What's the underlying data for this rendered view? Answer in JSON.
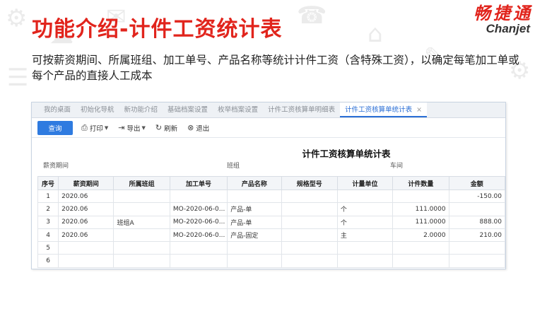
{
  "slide": {
    "title": "功能介绍-计件工资统计表",
    "logo_cn": "畅捷通",
    "logo_en": "Chanjet",
    "description": "可按薪资期间、所属班组、加工单号、产品名称等统计计件工资（含特殊工资），以确定每笔加工单或每个产品的直接人工成本"
  },
  "tabs": [
    {
      "label": "我的桌面"
    },
    {
      "label": "初始化导航"
    },
    {
      "label": "新功能介绍"
    },
    {
      "label": "基础档案设置"
    },
    {
      "label": "枚举档案设置"
    },
    {
      "label": "计件工资核算单明细表"
    },
    {
      "label": "计件工资核算单统计表",
      "active": true,
      "close": "×"
    }
  ],
  "toolbar": {
    "query": "查询",
    "print": "打印",
    "export": "导出",
    "refresh": "刷新",
    "exit": "退出"
  },
  "report": {
    "title": "计件工资核算单统计表",
    "filter_period": "薪资期间",
    "filter_group": "班组",
    "filter_workshop": "车间"
  },
  "table": {
    "headers": [
      "序号",
      "薪资期间",
      "所属班组",
      "加工单号",
      "产品名称",
      "规格型号",
      "计量单位",
      "计件数量",
      "金额"
    ],
    "rows": [
      [
        "1",
        "2020.06",
        "",
        "",
        "",
        "",
        "",
        "",
        "-150.00"
      ],
      [
        "2",
        "2020.06",
        "",
        "MO-2020-06-0...",
        "产品-单",
        "",
        "个",
        "111.0000",
        ""
      ],
      [
        "3",
        "2020.06",
        "班组A",
        "MO-2020-06-0...",
        "产品-单",
        "",
        "个",
        "111.0000",
        "888.00"
      ],
      [
        "4",
        "2020.06",
        "",
        "MO-2020-06-0...",
        "产品-固定",
        "",
        "主",
        "2.0000",
        "210.00"
      ],
      [
        "5",
        "",
        "",
        "",
        "",
        "",
        "",
        "",
        ""
      ],
      [
        "6",
        "",
        "",
        "",
        "",
        "",
        "",
        "",
        ""
      ]
    ]
  },
  "colors": {
    "title_red": "#e1241c",
    "primary_blue": "#2f7be0",
    "link_blue": "#2b44c8"
  }
}
